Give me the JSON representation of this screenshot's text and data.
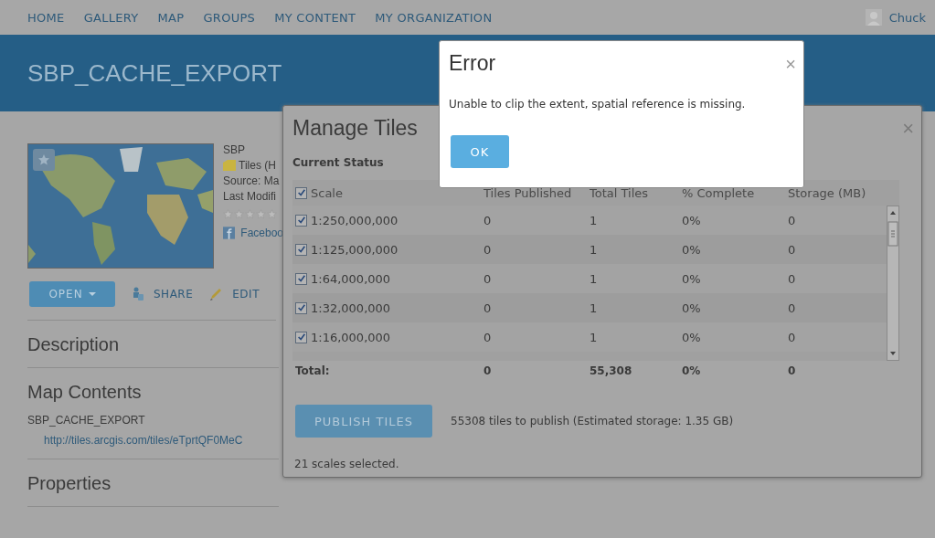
{
  "nav": {
    "items": [
      "HOME",
      "GALLERY",
      "MAP",
      "GROUPS",
      "MY CONTENT",
      "MY ORGANIZATION"
    ],
    "user": "Chuck"
  },
  "banner": {
    "title": "SBP_CACHE_EXPORT"
  },
  "item": {
    "owner": "SBP",
    "type": "Tiles (H",
    "source": "Source: Ma",
    "modified": "Last Modifi",
    "stars": 0,
    "share_link": "Faceboo"
  },
  "actions": [
    {
      "kind": "dropdown",
      "label": "OPEN"
    },
    {
      "kind": "share",
      "label": "SHARE"
    },
    {
      "kind": "edit",
      "label": "EDIT"
    }
  ],
  "sections": [
    {
      "title": "Description"
    },
    {
      "title": "Map Contents",
      "layer": "SBP_CACHE_EXPORT",
      "url": "http://tiles.arcgis.com/tiles/eTprtQF0MeC"
    },
    {
      "title": "Properties"
    }
  ],
  "manage_tiles": {
    "title": "Manage Tiles",
    "close": "×",
    "subtitle": "Current Status",
    "table": {
      "select_all": {
        "checked": true
      },
      "columns": [
        "Scale",
        "Tiles Published",
        "Total Tiles",
        "% Complete",
        "Storage (MB)"
      ],
      "rows": [
        {
          "checked": true,
          "cells": [
            "1:250,000,000",
            "0",
            "1",
            "0%",
            "0"
          ]
        },
        {
          "checked": true,
          "cells": [
            "1:125,000,000",
            "0",
            "1",
            "0%",
            "0"
          ]
        },
        {
          "checked": true,
          "cells": [
            "1:64,000,000",
            "0",
            "1",
            "0%",
            "0"
          ]
        },
        {
          "checked": true,
          "cells": [
            "1:32,000,000",
            "0",
            "1",
            "0%",
            "0"
          ]
        },
        {
          "checked": true,
          "cells": [
            "1:16,000,000",
            "0",
            "1",
            "0%",
            "0"
          ]
        }
      ],
      "total": [
        "Total:",
        "0",
        "55,308",
        "0%",
        "0"
      ]
    },
    "publish_button": "PUBLISH TILES",
    "estimate": "55308 tiles to publish (Estimated storage: 1.35 GB)",
    "selection": "21 scales selected."
  },
  "error": {
    "title": "Error",
    "close": "×",
    "message": "Unable to clip the extent, spatial reference is missing.",
    "button": "OK"
  }
}
